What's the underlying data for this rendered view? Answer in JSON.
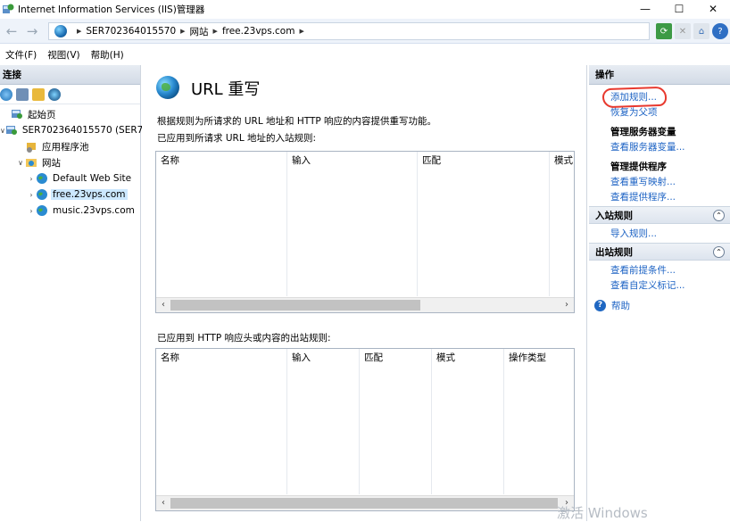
{
  "window": {
    "title": "Internet Information Services (IIS)管理器",
    "minimize": "—",
    "maximize": "☐",
    "close": "✕"
  },
  "address": {
    "crumbs": [
      "SER702364015570",
      "网站",
      "free.23vps.com"
    ]
  },
  "menu": [
    "文件(F)",
    "视图(V)",
    "帮助(H)"
  ],
  "connections": {
    "title": "连接",
    "tree": [
      {
        "label": "起始页",
        "level": 0,
        "icon": "start-page-icon"
      },
      {
        "label": "SER702364015570 (SER702",
        "level": 0,
        "icon": "server-icon",
        "expanded": true
      },
      {
        "label": "应用程序池",
        "level": 1,
        "icon": "app-pool-icon"
      },
      {
        "label": "网站",
        "level": 1,
        "icon": "sites-folder-icon",
        "expanded": true
      },
      {
        "label": "Default Web Site",
        "level": 2,
        "icon": "globe-icon"
      },
      {
        "label": "free.23vps.com",
        "level": 2,
        "icon": "globe-icon",
        "selected": true
      },
      {
        "label": "music.23vps.com",
        "level": 2,
        "icon": "globe-icon"
      }
    ]
  },
  "feature": {
    "title": "URL 重写",
    "description": "根据规则为所请求的 URL 地址和 HTTP 响应的内容提供重写功能。",
    "inbound_label": "已应用到所请求 URL 地址的入站规则:",
    "inbound_columns": [
      "名称",
      "输入",
      "匹配",
      "模式"
    ],
    "outbound_label": "已应用到 HTTP 响应头或内容的出站规则:",
    "outbound_columns": [
      "名称",
      "输入",
      "匹配",
      "模式",
      "操作类型"
    ]
  },
  "actions": {
    "title": "操作",
    "add_rule": "添加规则...",
    "revert": "恢复为父项",
    "server_vars_title": "管理服务器变量",
    "view_server_vars": "查看服务器变量...",
    "providers_title": "管理提供程序",
    "view_rewrite_maps": "查看重写映射...",
    "view_providers": "查看提供程序...",
    "inbound_title": "入站规则",
    "import_rules": "导入规则...",
    "outbound_title": "出站规则",
    "view_preconditions": "查看前提条件...",
    "view_custom_tags": "查看自定义标记...",
    "help": "帮助"
  },
  "watermark": "激活 Windows",
  "colors": {
    "link": "#1d63c4",
    "highlight": "#e8392e",
    "selected": "#cce8ff"
  }
}
